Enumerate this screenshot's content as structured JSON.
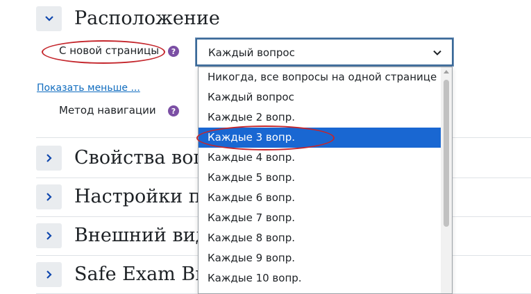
{
  "sections": {
    "layout": {
      "title": "Расположение"
    },
    "question_behaviour": {
      "title": "Свойства вопросов"
    },
    "review_options": {
      "title": "Настройки просмотра"
    },
    "appearance": {
      "title": "Внешний вид"
    },
    "seb": {
      "title": "Safe Exam Browser"
    }
  },
  "fields": {
    "new_page": {
      "label": "С новой страницы",
      "value": "Каждый вопрос"
    },
    "nav_method": {
      "label": "Метод навигации"
    },
    "help_glyph": "?"
  },
  "show_less": "Показать меньше ...",
  "dropdown": {
    "options": [
      "Никогда, все вопросы на одной странице",
      "Каждый вопрос",
      "Каждые 2 вопр.",
      "Каждые 3 вопр.",
      "Каждые 4 вопр.",
      "Каждые 5 вопр.",
      "Каждые 6 вопр.",
      "Каждые 7 вопр.",
      "Каждые 8 вопр.",
      "Каждые 9 вопр.",
      "Каждые 10 вопр."
    ],
    "highlighted_index": 3
  },
  "colors": {
    "highlight": "#1967d2",
    "annotation": "#c4262c",
    "help": "#7b4fa4",
    "link": "#0f6cbf"
  }
}
